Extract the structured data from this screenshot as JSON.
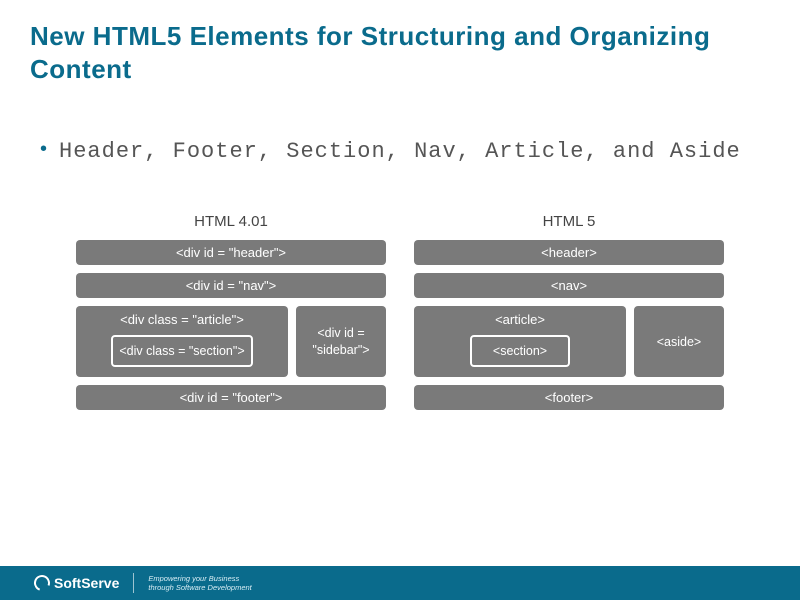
{
  "title": "New HTML5 Elements for Structuring and Organizing Content",
  "bullet": "Header, Footer, Section, Nav, Article, and Aside",
  "diagrams": {
    "left": {
      "label": "HTML 4.01",
      "header": "<div id = \"header\">",
      "nav": "<div id = \"nav\">",
      "article": "<div class = \"article\">",
      "section": "<div class = \"section\">",
      "sidebar": "<div id = \"sidebar\">",
      "footer": "<div id = \"footer\">"
    },
    "right": {
      "label": "HTML 5",
      "header": "<header>",
      "nav": "<nav>",
      "article": "<article>",
      "section": "<section>",
      "aside": "<aside>",
      "footer": "<footer>"
    }
  },
  "footer": {
    "brand": "SoftServe",
    "tagline1": "Empowering your Business",
    "tagline2": "through Software Development"
  }
}
